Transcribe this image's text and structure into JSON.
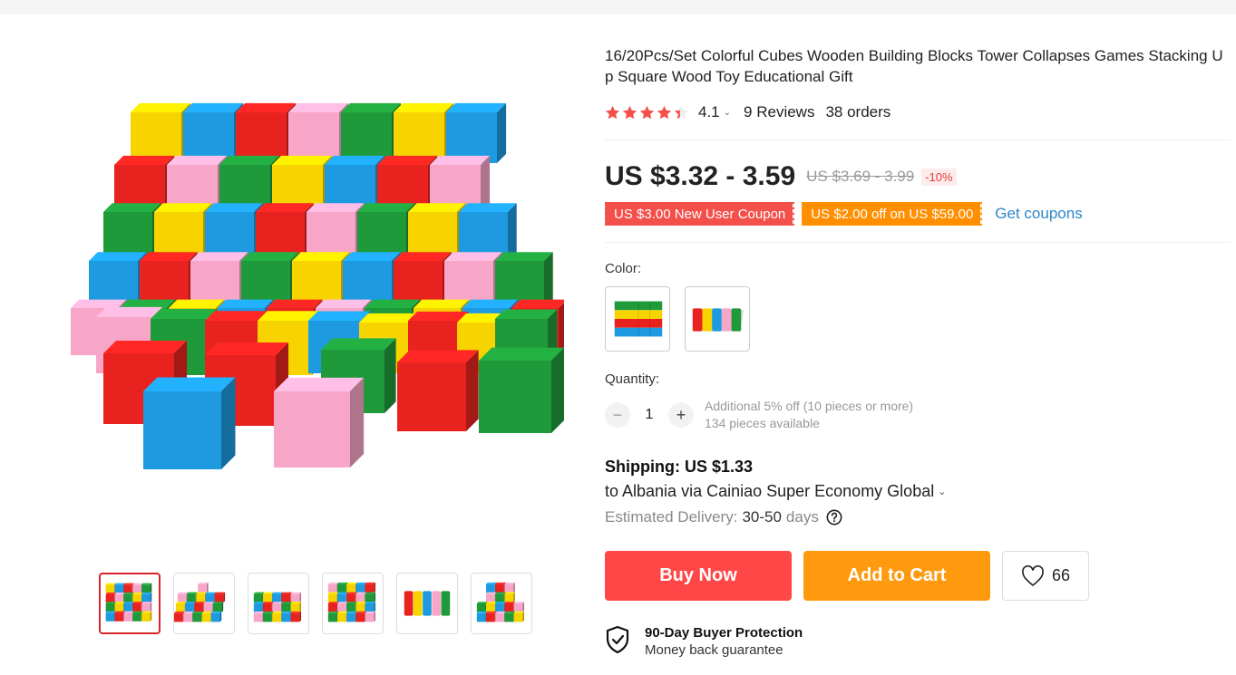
{
  "product": {
    "title": "16/20Pcs/Set Colorful Cubes Wooden Building Blocks Tower Collapses Games Stacking Up Square Wood Toy Educational Gift",
    "rating": "4.1",
    "reviews": "9 Reviews",
    "orders": "38 orders",
    "price": "US $3.32 - 3.59",
    "old_price": "US $3.69 - 3.99",
    "discount": "-10%",
    "star_fill": 0.82
  },
  "coupons": {
    "new_user": "US $3.00 New User Coupon",
    "store": "US $2.00 off on US $59.00",
    "get_coupons": "Get coupons"
  },
  "color": {
    "label": "Color:"
  },
  "quantity": {
    "label": "Quantity:",
    "minus": "−",
    "value": "1",
    "plus": "+",
    "discount_note": "Additional 5% off (10 pieces or more)",
    "available": "134 pieces available"
  },
  "shipping": {
    "title": "Shipping: US $1.33",
    "route": "to Albania via Cainiao Super Economy Global",
    "delivery_label": "Estimated Delivery:",
    "delivery_days": "30-50",
    "delivery_unit": "days"
  },
  "actions": {
    "buy_now": "Buy Now",
    "add_to_cart": "Add to Cart",
    "wishlist_count": "66"
  },
  "protection": {
    "title": "90-Day Buyer Protection",
    "subtitle": "Money back guarantee"
  },
  "colors": {
    "red": "#e8231f",
    "blue": "#1e9be0",
    "green": "#1f9a3a",
    "yellow": "#f7d300",
    "pink": "#f7a6c8",
    "accent_buy": "#ff4747",
    "accent_cart": "#ff9a0e",
    "link": "#2e86c8"
  },
  "icons": {
    "rating": "star-icon",
    "help": "question-circle-icon",
    "wishlist": "heart-icon",
    "protection": "shield-check-icon"
  }
}
